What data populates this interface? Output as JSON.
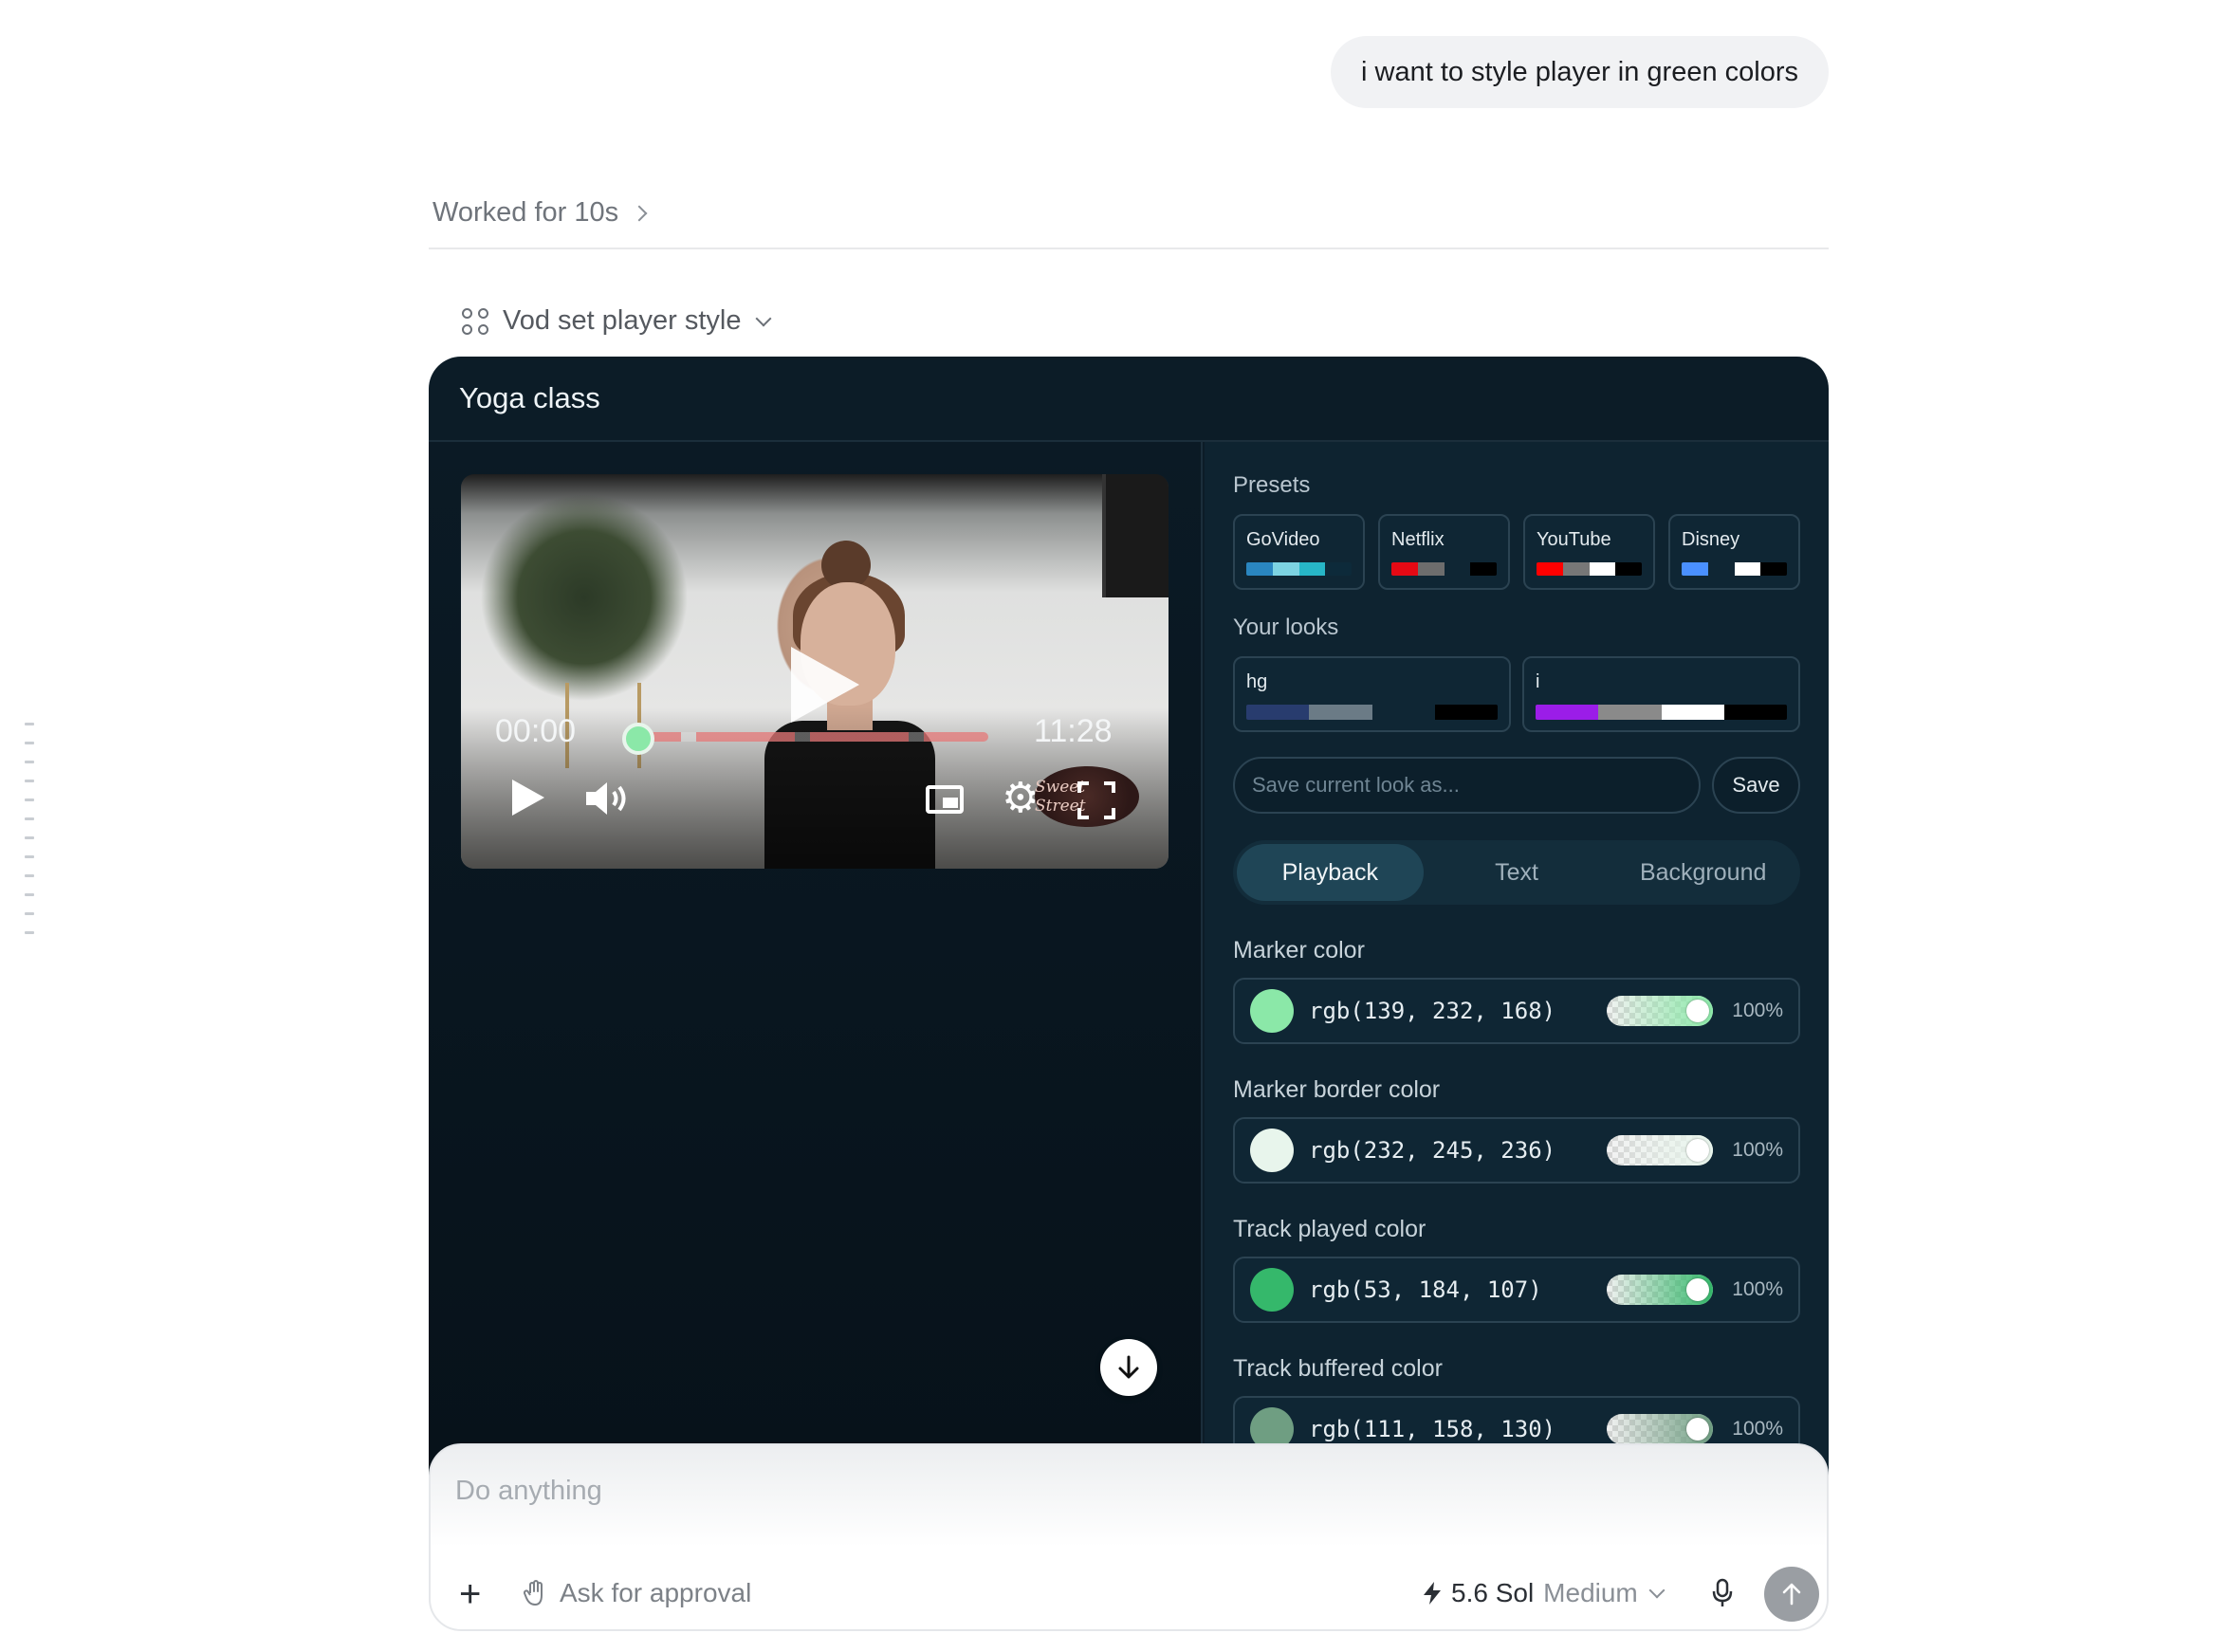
{
  "chat": {
    "user_message": "i want to style player in green colors",
    "worked_label": "Worked for 10s",
    "tool_label": "Vod set player style"
  },
  "player_card": {
    "title": "Yoga class",
    "video": {
      "current_time": "00:00",
      "duration": "11:28",
      "logo_text": "Sweet Street",
      "progress_fraction": 0
    }
  },
  "settings": {
    "presets_label": "Presets",
    "presets": [
      {
        "name": "GoVideo",
        "colors": [
          "#2a86c0",
          "#7dd3e2",
          "#27b6c7",
          "#0d2a3a"
        ]
      },
      {
        "name": "Netflix",
        "colors": [
          "#e50914",
          "#6d6d6d",
          "#0f2634",
          "#000000"
        ]
      },
      {
        "name": "YouTube",
        "colors": [
          "#ff0000",
          "#777777",
          "#ffffff",
          "#000000"
        ]
      },
      {
        "name": "Disney",
        "colors": [
          "#4a90ff",
          "#0f2634",
          "#ffffff",
          "#000000"
        ]
      }
    ],
    "looks_label": "Your looks",
    "looks": [
      {
        "name": "hg",
        "colors": [
          "#283c6e",
          "#6b7b86",
          "#0f2634",
          "#000000"
        ]
      },
      {
        "name": "i",
        "colors": [
          "#9b1de8",
          "#8a8a8a",
          "#ffffff",
          "#000000"
        ]
      }
    ],
    "save_placeholder": "Save current look as...",
    "save_label": "Save",
    "tabs": [
      "Playback",
      "Text",
      "Background"
    ],
    "active_tab": "Playback",
    "colors": [
      {
        "label": "Marker color",
        "value": "rgb(139, 232, 168)",
        "hex": "#8be8a8",
        "alpha": "100%"
      },
      {
        "label": "Marker border color",
        "value": "rgb(232, 245, 236)",
        "hex": "#e8f5ec",
        "alpha": "100%"
      },
      {
        "label": "Track played color",
        "value": "rgb(53, 184, 107)",
        "hex": "#35b86b",
        "alpha": "100%"
      },
      {
        "label": "Track buffered color",
        "value": "rgb(111, 158, 130)",
        "hex": "#6f9e82",
        "alpha": "100%"
      }
    ]
  },
  "composer": {
    "placeholder": "Do anything",
    "approval_label": "Ask for approval",
    "model_name": "5.6 Sol",
    "model_effort": "Medium"
  },
  "theme": {
    "card_bg": "#0c1c27",
    "accent_green": "#35b86b"
  }
}
